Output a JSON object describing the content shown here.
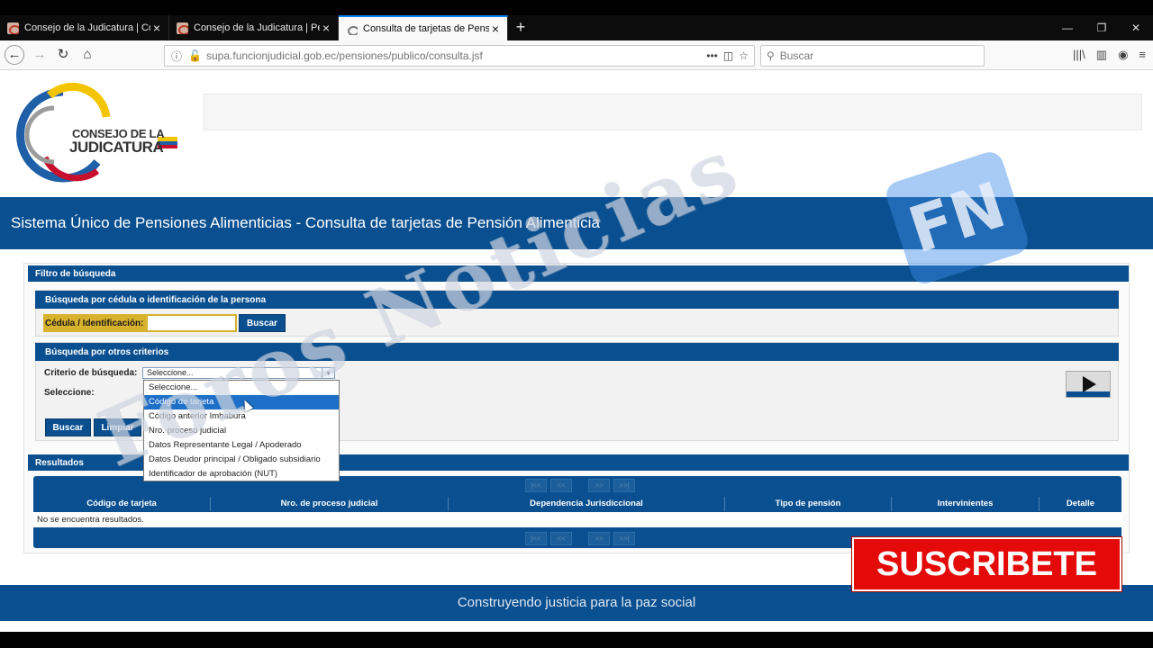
{
  "browser": {
    "tabs": [
      {
        "title": "Consejo de la Judicatura | Cons"
      },
      {
        "title": "Consejo de la Judicatura | Pensi"
      },
      {
        "title": "Consulta de tarjetas de Pensión"
      }
    ],
    "new_tab": "+",
    "url": "supa.funcionjudicial.gob.ec/pensiones/publico/consulta.jsf",
    "url_domain": "funcionjudicial.gob.ec",
    "search_placeholder": "Buscar",
    "icons": {
      "back": "back-arrow-icon",
      "forward": "forward-arrow-icon",
      "reload": "reload-icon",
      "home": "home-icon",
      "library": "library-icon",
      "sidebar": "sidebar-icon",
      "account": "account-icon",
      "menu": "hamburger-menu-icon"
    }
  },
  "header": {
    "logo_line1": "CONSEJO DE LA",
    "logo_line2": "JUDICATURA"
  },
  "banner": {
    "title": "Sistema Único de Pensiones Alimenticias - Consulta de tarjetas de Pensión Alimenticia"
  },
  "filter": {
    "title": "Filtro de búsqueda",
    "by_id": {
      "title": "Búsqueda por cédula o identificación de la persona",
      "label": "Cédula / Identificación:",
      "value": "",
      "button": "Buscar"
    },
    "by_other": {
      "title": "Búsqueda por otros criterios",
      "criteria_label": "Criterio de búsqueda:",
      "criteria_value": "Seleccione...",
      "select_label": "Seleccione:",
      "options": [
        "Seleccione...",
        "Código de tarjeta",
        "Código anterior Imbabura",
        "Nro. proceso judicial",
        "Datos Representante Legal / Apoderado",
        "Datos Deudor principal / Obligado subsidiario",
        "Identificador de aprobación (NUT)"
      ],
      "highlighted_option": "Código de tarjeta",
      "search_button": "Buscar",
      "clear_button": "Limpiar"
    }
  },
  "results": {
    "title": "Resultados",
    "columns": [
      "Código de tarjeta",
      "Nro. de proceso judicial",
      "Dependencia Jurisdiccional",
      "Tipo de pensión",
      "Intervinientes",
      "Detalle"
    ],
    "empty_message": "No se encuentra resultados.",
    "pager": [
      "|<<",
      "<<",
      ">>",
      ">>|"
    ]
  },
  "footer": {
    "text": "Construyendo justicia para la paz social"
  },
  "overlay": {
    "subscribe": "SUSCRIBETE",
    "watermark": "Foros Noticias",
    "badge": "FN"
  },
  "colors": {
    "primary_blue": "#0a4f8f",
    "id_label_gold": "#d8b22c",
    "highlight": "#1e6fc7",
    "subscribe_red": "#e50a0a"
  }
}
